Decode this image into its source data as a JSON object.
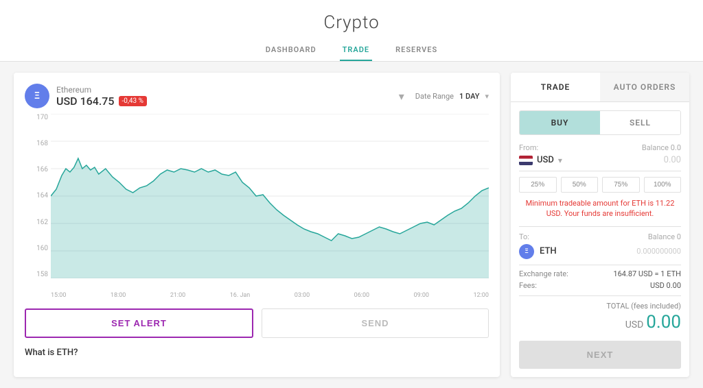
{
  "app": {
    "title": "Crypto"
  },
  "nav": {
    "tabs": [
      {
        "label": "DASHBOARD",
        "active": false
      },
      {
        "label": "TRADE",
        "active": true
      },
      {
        "label": "RESERVES",
        "active": false
      }
    ]
  },
  "chart": {
    "coin_name": "Ethereum",
    "coin_symbol": "ETH",
    "price_label": "USD 164.75",
    "price_change": "-0,43 %",
    "date_range_label": "Date Range",
    "date_range_value": "1 DAY",
    "y_labels": [
      "170",
      "168",
      "166",
      "164",
      "162",
      "160",
      "158"
    ],
    "x_labels": [
      "15:00",
      "18:00",
      "21:00",
      "16. Jan",
      "03:00",
      "06:00",
      "09:00",
      "12:00"
    ]
  },
  "buttons": {
    "set_alert": "SET ALERT",
    "send": "SEND"
  },
  "info": {
    "what_is_label": "What is ETH?"
  },
  "right_panel": {
    "tabs": [
      {
        "label": "TRADE",
        "active": true
      },
      {
        "label": "AUTO ORDERS",
        "active": false
      }
    ],
    "buy_sell_tabs": [
      {
        "label": "BUY",
        "active": true
      },
      {
        "label": "SELL",
        "active": false
      }
    ],
    "from_label": "From:",
    "balance_label": "Balance 0.0",
    "currency_name": "USD",
    "currency_amount": "0.00",
    "percent_options": [
      "25%",
      "50%",
      "75%",
      "100%"
    ],
    "warning_text": "Minimum tradeable amount for ETH is 11.22 USD. Your funds are insufficient.",
    "to_label": "To:",
    "to_balance": "Balance 0",
    "to_coin": "ETH",
    "to_amount": "0.000000000",
    "exchange_rate_label": "Exchange rate:",
    "exchange_rate_value": "164.87 USD = 1 ETH",
    "fees_label": "Fees:",
    "fees_value": "USD 0.00",
    "total_label": "TOTAL (fees included)",
    "total_currency": "USD",
    "total_value": "0.00",
    "next_button": "NEXT"
  }
}
